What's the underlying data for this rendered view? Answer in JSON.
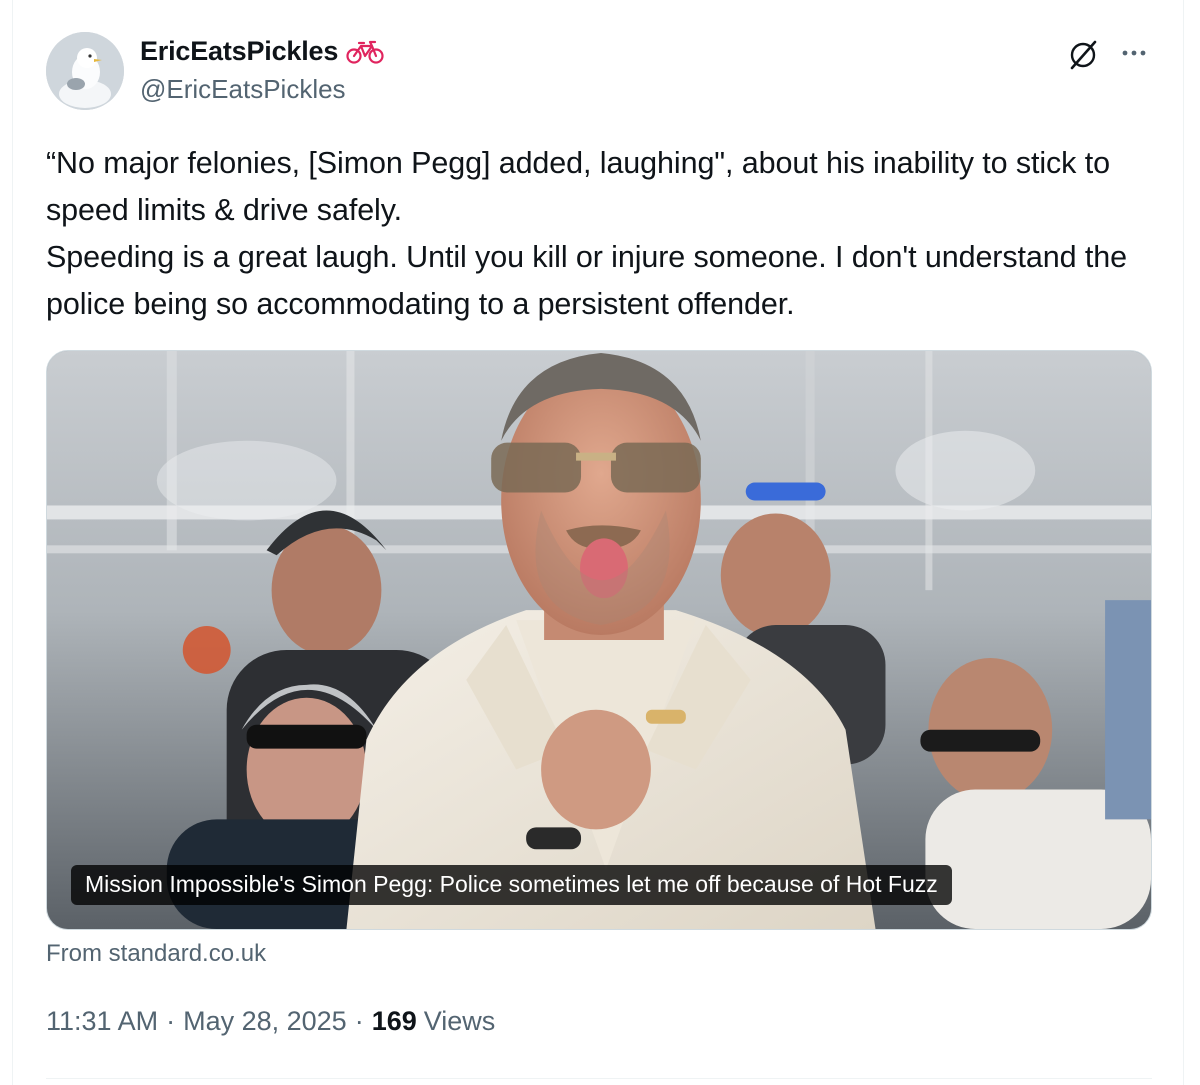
{
  "author": {
    "display_name": "EricEatsPickles",
    "handle": "@EricEatsPickles",
    "badge_icon": "bicycle-icon",
    "avatar_icon": "seagull-avatar"
  },
  "header_actions": {
    "grok_icon": "grok-icon",
    "more_icon": "more-icon"
  },
  "tweet": {
    "text": "“No major felonies, [Simon Pegg] added, laughing\", about his inability to stick to speed limits & drive safely.\nSpeeding is a great laugh. Until you kill or injure someone. I don't understand the police being so accommodating to a persistent offender."
  },
  "link_card": {
    "caption": "Mission Impossible's Simon Pegg: Police sometimes let me off because of Hot Fuzz",
    "source": "From standard.co.uk"
  },
  "meta": {
    "time": "11:31 AM",
    "date": "May 28, 2025",
    "views_count": "169",
    "views_label": "Views",
    "separator": "·"
  },
  "colors": {
    "text_primary": "#0f1419",
    "text_secondary": "#536471",
    "border": "#cfd9de",
    "bike_red": "#e0245e"
  }
}
